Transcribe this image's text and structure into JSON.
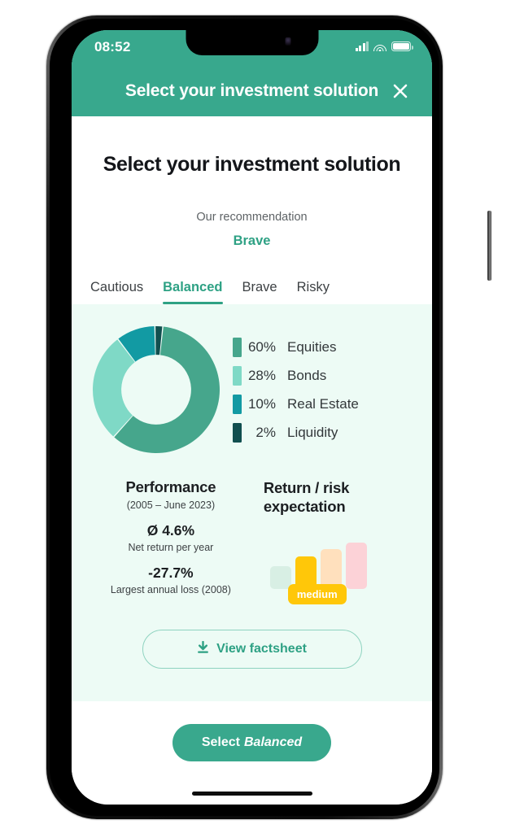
{
  "statusbar": {
    "time": "08:52",
    "signal_icon": "cellular-signal-icon",
    "wifi_icon": "wifi-icon",
    "battery_icon": "battery-icon"
  },
  "appbar": {
    "title": "Select your investment solution",
    "close_icon": "close-icon"
  },
  "page": {
    "title": "Select your investment solution",
    "recommendation_label": "Our recommendation",
    "recommendation_value": "Brave"
  },
  "tabs": [
    {
      "label": "Cautious",
      "active": false
    },
    {
      "label": "Balanced",
      "active": true
    },
    {
      "label": "Brave",
      "active": false
    },
    {
      "label": "Risky",
      "active": false
    }
  ],
  "performance": {
    "title": "Performance",
    "range": "(2005 – June 2023)",
    "net_return_value": "Ø 4.6%",
    "net_return_label": "Net return per year",
    "largest_loss_value": "-27.7%",
    "largest_loss_label": "Largest annual loss (2008)"
  },
  "risk": {
    "title": "Return / risk expectation",
    "badge": "medium"
  },
  "buttons": {
    "factsheet_label": "View factsheet",
    "factsheet_icon": "download-icon",
    "select_prefix": "Select",
    "select_emphasis": "Balanced"
  },
  "colors": {
    "brand_green": "#38a88d",
    "accent_green": "#2ea184",
    "panel_bg": "#edfbf5",
    "equities": "#46a68c",
    "bonds": "#7fd9c6",
    "real_estate": "#129aa3",
    "liquidity": "#114f4f",
    "risk_badge": "#ffc709"
  },
  "chart_data": [
    {
      "type": "pie",
      "title": "Asset allocation",
      "legend_position": "right",
      "categories": [
        "Equities",
        "Bonds",
        "Real Estate",
        "Liquidity"
      ],
      "values": [
        60,
        28,
        10,
        2
      ],
      "value_labels": [
        "60%",
        "28%",
        "10%",
        "2%"
      ],
      "colors": [
        "#46a68c",
        "#7fd9c6",
        "#129aa3",
        "#114f4f"
      ],
      "donut": true,
      "inner_radius_ratio": 0.55
    },
    {
      "type": "bar",
      "title": "Return / risk expectation",
      "categories": [
        "cautious",
        "balanced",
        "brave",
        "risky"
      ],
      "values": [
        38,
        55,
        66,
        78
      ],
      "ylim": [
        0,
        100
      ],
      "colors": [
        "#d8efe4",
        "#ffc709",
        "#ffe0bd",
        "#fcd2d7"
      ],
      "annotation": "medium",
      "highlight_index": 1,
      "grid": false,
      "xlabel": "",
      "ylabel": ""
    }
  ]
}
